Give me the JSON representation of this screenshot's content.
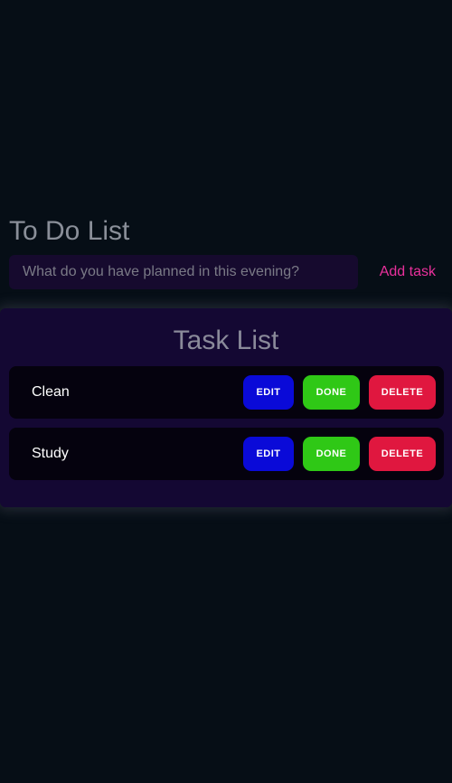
{
  "header": {
    "title": "To Do List"
  },
  "add_task": {
    "placeholder": "What do you have planned in this evening?",
    "value": "",
    "button_label": "Add task"
  },
  "task_list": {
    "title": "Task List",
    "tasks": [
      {
        "name": "Clean",
        "edit_label": "EDIT",
        "done_label": "DONE",
        "delete_label": "DELETE"
      },
      {
        "name": "Study",
        "edit_label": "EDIT",
        "done_label": "DONE",
        "delete_label": "DELETE"
      }
    ]
  },
  "colors": {
    "background": "#060e16",
    "panel": "#140833",
    "accent": "#e9309c",
    "edit": "#0a0ad8",
    "done": "#2fc816",
    "delete": "#e0173f"
  }
}
